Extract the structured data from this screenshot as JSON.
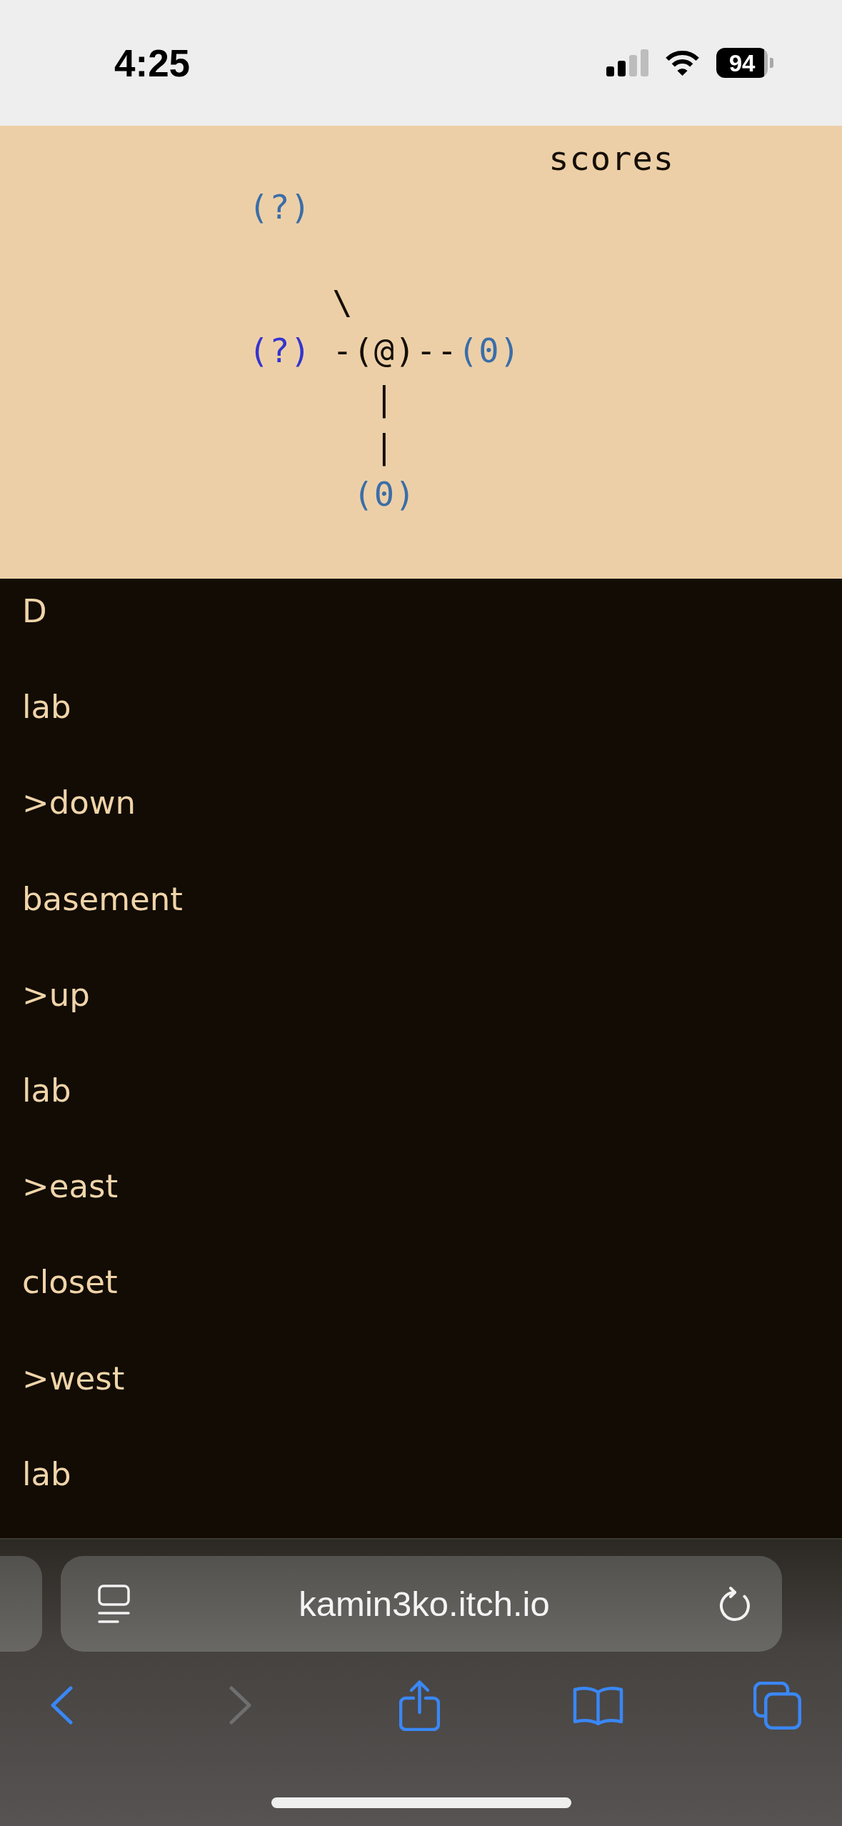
{
  "status_bar": {
    "time": "4:25",
    "battery": "94"
  },
  "map": {
    "scores_link": "scores",
    "rows": [
      [
        {
          "text": "(?)",
          "kind": "room",
          "color": "#3a6ea8"
        }
      ],
      [],
      [
        "",
        {
          "text": "\\",
          "kind": "link"
        }
      ],
      [
        {
          "text": "(?)",
          "kind": "room",
          "color": "#3434d0"
        },
        {
          "text": "-",
          "kind": "link"
        },
        {
          "text": "(@)",
          "kind": "player"
        },
        {
          "text": "--",
          "kind": "link"
        },
        {
          "text": "(0)",
          "kind": "room",
          "color": "#3a6ea8"
        }
      ],
      [
        "",
        "",
        {
          "text": "|",
          "kind": "link"
        }
      ],
      [
        "",
        "",
        {
          "text": "|",
          "kind": "link"
        }
      ],
      [
        "",
        "",
        {
          "text": "(0)",
          "kind": "room",
          "color": "#3a6ea8"
        }
      ]
    ]
  },
  "log": [
    "D",
    "lab",
    ">down",
    "basement",
    ">up",
    "lab",
    ">east",
    "closet",
    ">west",
    "lab"
  ],
  "browser": {
    "url": "kamin3ko.itch.io",
    "toolbar": [
      {
        "kind": "back",
        "disabled": false
      },
      {
        "kind": "forward",
        "disabled": true
      },
      {
        "kind": "share",
        "disabled": false
      },
      {
        "kind": "bookmarks",
        "disabled": false
      },
      {
        "kind": "tabs",
        "disabled": false
      }
    ]
  }
}
